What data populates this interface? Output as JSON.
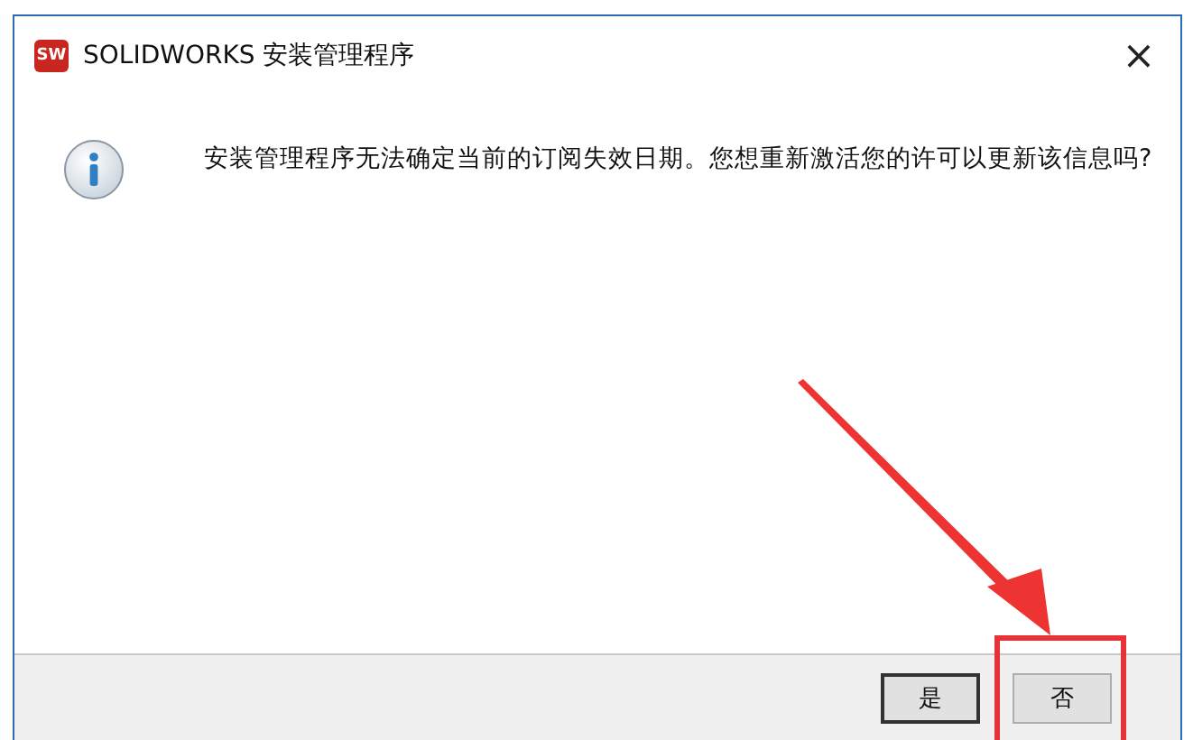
{
  "window": {
    "title": "SOLIDWORKS 安装管理程序",
    "close": "×"
  },
  "logo": {
    "text": "SW"
  },
  "message": "安装管理程序无法确定当前的订阅失效日期。您想重新激活您的许可以更新该信息吗?",
  "buttons": [
    {
      "label": "是",
      "default": true,
      "highlighted": false
    },
    {
      "label": "否",
      "default": false,
      "highlighted": true
    }
  ]
}
